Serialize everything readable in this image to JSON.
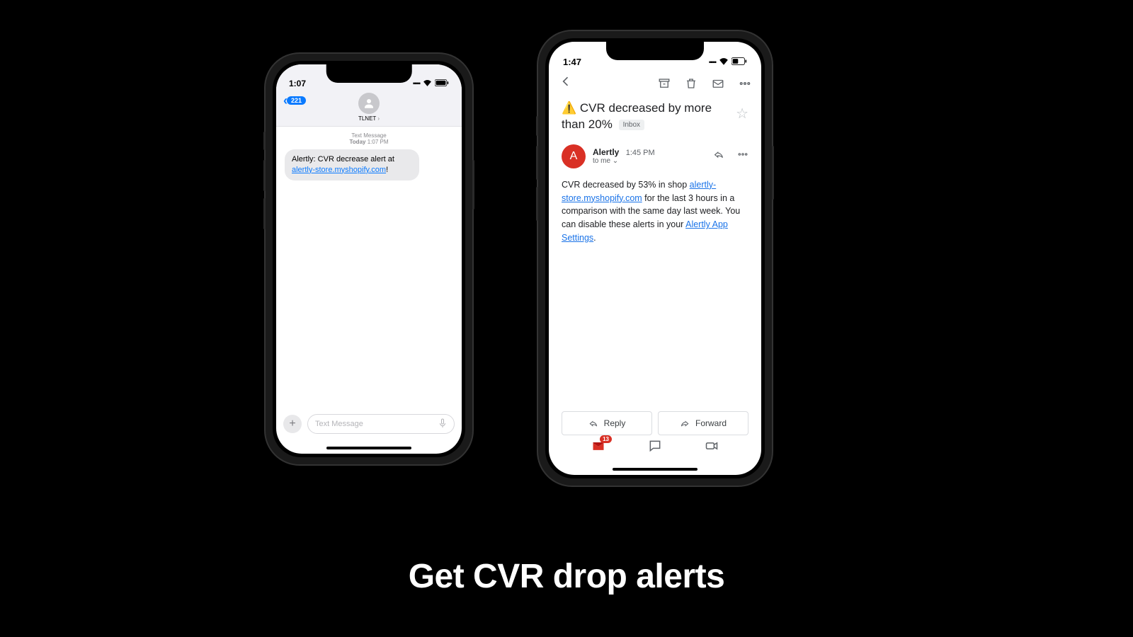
{
  "tagline": "Get CVR drop alerts",
  "sms_phone": {
    "time": "1:07",
    "back_count": "221",
    "contact": "TLNET",
    "meta_label": "Text Message",
    "meta_time_prefix": "Today",
    "meta_time": "1:07 PM",
    "bubble_prefix": "Alertly: CVR decrease alert at ",
    "bubble_link": "alertly-store.myshopify.com",
    "bubble_suffix": "!",
    "compose_placeholder": "Text Message"
  },
  "email_phone": {
    "time": "1:47",
    "subject_emoji": "⚠️",
    "subject_text": "CVR decreased by more than 20%",
    "inbox_label": "Inbox",
    "sender_initial": "A",
    "sender_name": "Alertly",
    "sender_time": "1:45 PM",
    "to_line": "to me",
    "body_prefix": "CVR decreased by 53% in shop ",
    "body_link1": "alertly-store.myshopify.com",
    "body_middle": " for the last 3 hours in a comparison with the same day last week. You can disable these alerts in your ",
    "body_link2": "Alertly App Settings",
    "body_suffix": ".",
    "reply_label": "Reply",
    "forward_label": "Forward",
    "nav_badge": "13"
  }
}
